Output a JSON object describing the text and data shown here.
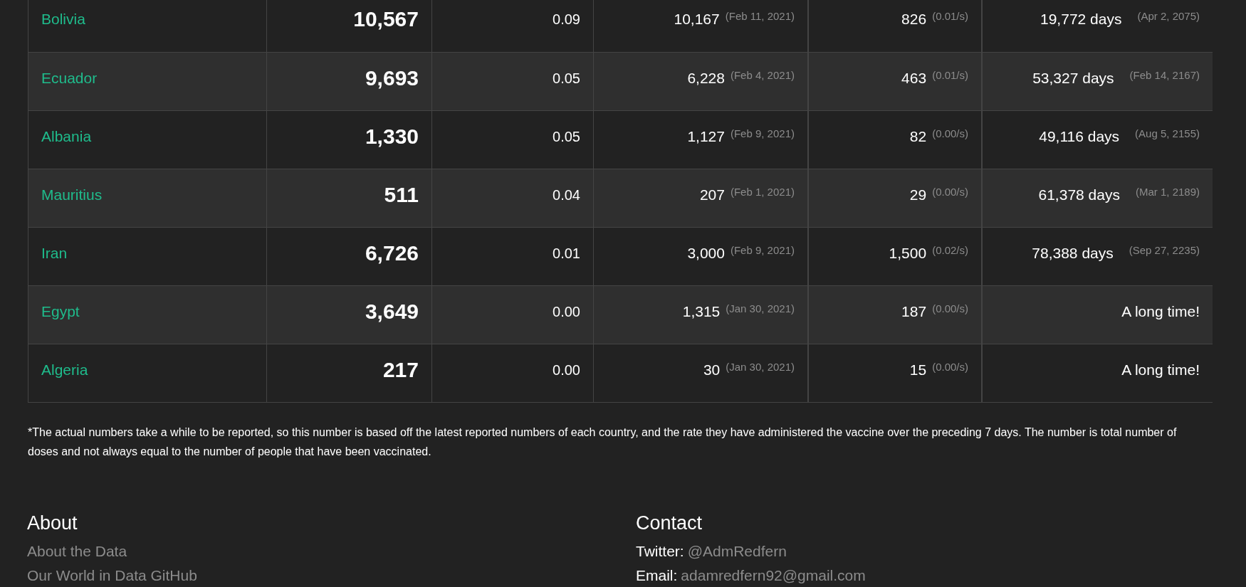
{
  "table": {
    "rows": [
      {
        "country": "Bolivia",
        "total": "10,567",
        "rate": "0.09",
        "reported": {
          "value": "10,167",
          "date": "(Feb 11, 2021)"
        },
        "per_day": {
          "value": "826",
          "rate": "(0.01/s)"
        },
        "eta": {
          "value": "19,772 days",
          "date": "(Apr 2, 2075)"
        }
      },
      {
        "country": "Ecuador",
        "total": "9,693",
        "rate": "0.05",
        "reported": {
          "value": "6,228",
          "date": "(Feb 4, 2021)"
        },
        "per_day": {
          "value": "463",
          "rate": "(0.01/s)"
        },
        "eta": {
          "value": "53,327 days",
          "date": "(Feb 14, 2167)"
        }
      },
      {
        "country": "Albania",
        "total": "1,330",
        "rate": "0.05",
        "reported": {
          "value": "1,127",
          "date": "(Feb 9, 2021)"
        },
        "per_day": {
          "value": "82",
          "rate": "(0.00/s)"
        },
        "eta": {
          "value": "49,116 days",
          "date": "(Aug 5, 2155)"
        }
      },
      {
        "country": "Mauritius",
        "total": "511",
        "rate": "0.04",
        "reported": {
          "value": "207",
          "date": "(Feb 1, 2021)"
        },
        "per_day": {
          "value": "29",
          "rate": "(0.00/s)"
        },
        "eta": {
          "value": "61,378 days",
          "date": "(Mar 1, 2189)"
        }
      },
      {
        "country": "Iran",
        "total": "6,726",
        "rate": "0.01",
        "reported": {
          "value": "3,000",
          "date": "(Feb 9, 2021)"
        },
        "per_day": {
          "value": "1,500",
          "rate": "(0.02/s)"
        },
        "eta": {
          "value": "78,388 days",
          "date": "(Sep 27, 2235)"
        }
      },
      {
        "country": "Egypt",
        "total": "3,649",
        "rate": "0.00",
        "reported": {
          "value": "1,315",
          "date": "(Jan 30, 2021)"
        },
        "per_day": {
          "value": "187",
          "rate": "(0.00/s)"
        },
        "eta": {
          "value": "A long time!"
        }
      },
      {
        "country": "Algeria",
        "total": "217",
        "rate": "0.00",
        "reported": {
          "value": "30",
          "date": "(Jan 30, 2021)"
        },
        "per_day": {
          "value": "15",
          "rate": "(0.00/s)"
        },
        "eta": {
          "value": "A long time!"
        }
      }
    ]
  },
  "footnote": "*The actual numbers take a while to be reported, so this number is based off the latest reported numbers of each country, and the rate they have administered the vaccine over the preceding 7 days. The number is total number of doses and not always equal to the number of people that have been vaccinated.",
  "footer": {
    "about": {
      "title": "About",
      "links": [
        "About the Data",
        "Our World in Data GitHub"
      ]
    },
    "contact": {
      "title": "Contact",
      "items": [
        {
          "label": "Twitter:",
          "value": "@AdmRedfern"
        },
        {
          "label": "Email:",
          "value": "adamredfern92@gmail.com"
        }
      ]
    }
  }
}
